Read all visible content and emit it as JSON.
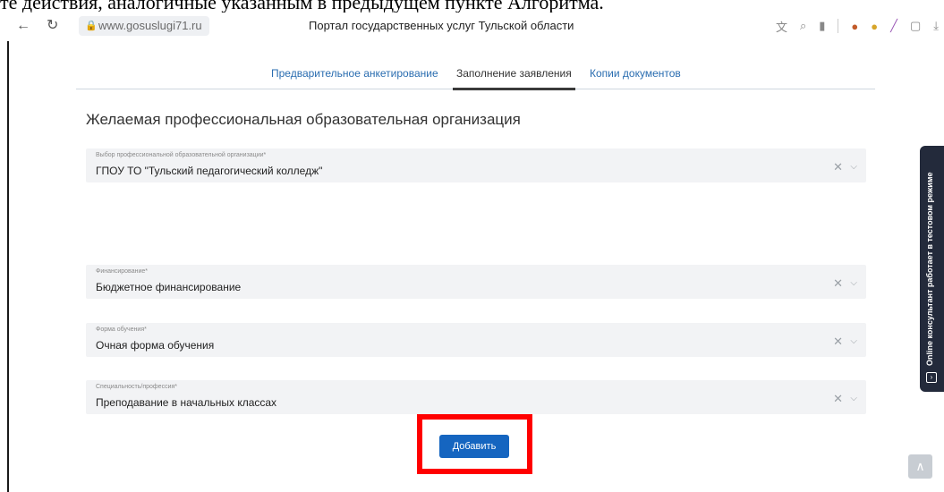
{
  "doc_text": "те действия, аналогичные указанным в предыдущем пункте Алгоритма.",
  "browser": {
    "back_icon": "←",
    "reload_icon": "↻",
    "url": "www.gosuslugi71.ru",
    "title": "Портал государственных услуг Тульской области"
  },
  "tabs": [
    {
      "label": "Предварительное анкетирование",
      "active": false
    },
    {
      "label": "Заполнение заявления",
      "active": true
    },
    {
      "label": "Копии документов",
      "active": false
    }
  ],
  "section_title": "Желаемая профессиональная образовательная организация",
  "fields": {
    "organization": {
      "label": "Выбор профессиональной образовательной организации*",
      "value": "ГПОУ ТО \"Тульский педагогический колледж\""
    },
    "financing": {
      "label": "Финансирование*",
      "value": "Бюджетное финансирование"
    },
    "study_form": {
      "label": "Форма обучения*",
      "value": "Очная форма обучения"
    },
    "specialty": {
      "label": "Специальность/профессия*",
      "value": "Преподавание в начальных классах"
    }
  },
  "add_button": "Добавить",
  "consultant_text": "Online консультант работает в тестовом режиме",
  "colors": {
    "accent": "#1565c0",
    "highlight": "#ff0000",
    "consultant_bg": "#232a3b"
  }
}
